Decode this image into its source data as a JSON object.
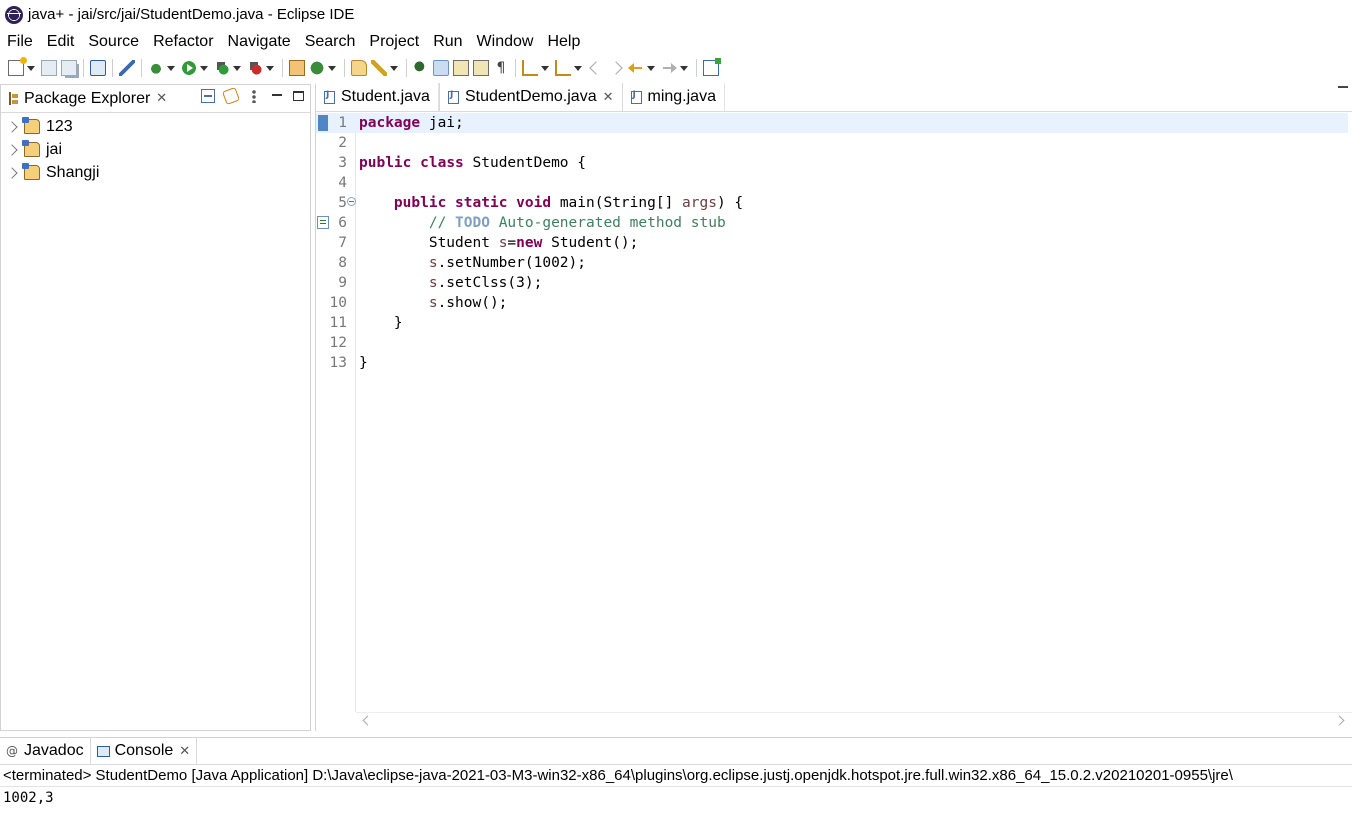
{
  "window": {
    "title": "java+ - jai/src/jai/StudentDemo.java - Eclipse IDE"
  },
  "menu": [
    "File",
    "Edit",
    "Source",
    "Refactor",
    "Navigate",
    "Search",
    "Project",
    "Run",
    "Window",
    "Help"
  ],
  "package_explorer": {
    "tab_label": "Package Explorer",
    "projects": [
      "123",
      "jai",
      "Shangji"
    ]
  },
  "editor": {
    "tabs": [
      {
        "label": "Student.java",
        "active": false
      },
      {
        "label": "StudentDemo.java",
        "active": true
      },
      {
        "label": "ming.java",
        "active": false
      }
    ],
    "line_numbers": [
      "1",
      "2",
      "3",
      "4",
      "5",
      "6",
      "7",
      "8",
      "9",
      "10",
      "11",
      "12",
      "13"
    ]
  },
  "bottom": {
    "tabs": [
      "Javadoc",
      "Console"
    ],
    "console_header": "<terminated> StudentDemo [Java Application] D:\\Java\\eclipse-java-2021-03-M3-win32-x86_64\\plugins\\org.eclipse.justj.openjdk.hotspot.jre.full.win32.x86_64_15.0.2.v20210201-0955\\jre\\",
    "console_output": "1002,3"
  },
  "colors": {
    "keyword": "#7f0055",
    "comment": "#3f7f5f",
    "todo": "#7f9fbf",
    "variable": "#6a3e3e",
    "current_line": "#e8f2fe"
  }
}
